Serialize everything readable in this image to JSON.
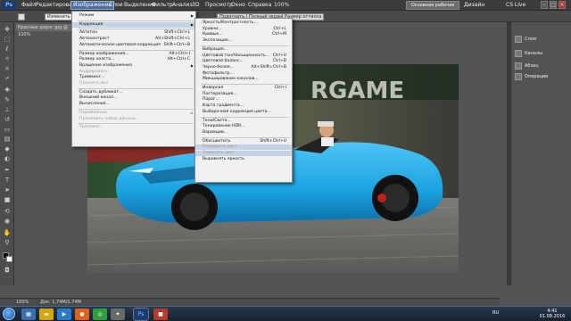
{
  "menubar": {
    "items": [
      "Файл",
      "Редактирование",
      "Изображение",
      "Слои",
      "Выделение",
      "Фильтр",
      "Анализ",
      "3D",
      "Просмотр",
      "Окно",
      "Справка"
    ],
    "zoom": "100%",
    "workspace_button": "Основная рабочая среда",
    "design_label": "Дизайн",
    "cs_live": "CS Live"
  },
  "options_bar": {
    "fit_label": "Изменить размер окон",
    "buttons": [
      "Подогнать",
      "Полный экран",
      "Размер оттиска"
    ]
  },
  "document_tab": {
    "title": "Красные дорог.jpg @ 100%"
  },
  "image_menu": {
    "items": [
      {
        "label": "Режим",
        "shortcut": "",
        "submenu": true
      },
      {
        "sep": true
      },
      {
        "label": "Коррекция",
        "shortcut": "",
        "submenu": true,
        "highlight": true
      },
      {
        "sep": true
      },
      {
        "label": "Автотон",
        "shortcut": "Shift+Ctrl+L"
      },
      {
        "label": "Автоконтраст",
        "shortcut": "Alt+Shift+Ctrl+L"
      },
      {
        "label": "Автоматическая цветовая коррекция",
        "shortcut": "Shift+Ctrl+B"
      },
      {
        "sep": true
      },
      {
        "label": "Размер изображения...",
        "shortcut": "Alt+Ctrl+I"
      },
      {
        "label": "Размер холста...",
        "shortcut": "Alt+Ctrl+C"
      },
      {
        "label": "Вращение изображения",
        "shortcut": "",
        "submenu": true
      },
      {
        "label": "Кадрировать",
        "shortcut": "",
        "disabled": true
      },
      {
        "label": "Тримминг...",
        "shortcut": ""
      },
      {
        "label": "Показать все",
        "shortcut": "",
        "disabled": true
      },
      {
        "sep": true
      },
      {
        "label": "Создать дубликат...",
        "shortcut": ""
      },
      {
        "label": "Внешний канал...",
        "shortcut": ""
      },
      {
        "label": "Вычисления...",
        "shortcut": ""
      },
      {
        "sep": true
      },
      {
        "label": "Переменные",
        "shortcut": "",
        "disabled": true,
        "submenu": true
      },
      {
        "label": "Применить набор данных...",
        "shortcut": "",
        "disabled": true
      },
      {
        "sep": true
      },
      {
        "label": "Треппинг...",
        "shortcut": "",
        "disabled": true
      }
    ]
  },
  "adjust_menu": {
    "items": [
      {
        "label": "Яркость/Контрастность...",
        "shortcut": ""
      },
      {
        "label": "Уровни...",
        "shortcut": "Ctrl+L"
      },
      {
        "label": "Кривые...",
        "shortcut": "Ctrl+M"
      },
      {
        "label": "Экспозиция...",
        "shortcut": ""
      },
      {
        "sep": true
      },
      {
        "label": "Вибрация...",
        "shortcut": ""
      },
      {
        "label": "Цветовой тон/Насыщенность...",
        "shortcut": "Ctrl+U"
      },
      {
        "label": "Цветовой баланс...",
        "shortcut": "Ctrl+B"
      },
      {
        "label": "Черно-белое...",
        "shortcut": "Alt+Shift+Ctrl+B"
      },
      {
        "label": "Фотофильтр...",
        "shortcut": ""
      },
      {
        "label": "Микширование каналов...",
        "shortcut": ""
      },
      {
        "sep": true
      },
      {
        "label": "Инверсия",
        "shortcut": "Ctrl+I"
      },
      {
        "label": "Постеризация...",
        "shortcut": ""
      },
      {
        "label": "Порог...",
        "shortcut": ""
      },
      {
        "label": "Карта градиента...",
        "shortcut": ""
      },
      {
        "label": "Выборочная коррекция цвета...",
        "shortcut": ""
      },
      {
        "sep": true
      },
      {
        "label": "Тени/Света...",
        "shortcut": ""
      },
      {
        "label": "Тонирование HDR...",
        "shortcut": ""
      },
      {
        "label": "Вариации...",
        "shortcut": ""
      },
      {
        "sep": true
      },
      {
        "label": "Обесцветить",
        "shortcut": "Shift+Ctrl+U"
      },
      {
        "label": "Подобрать цвет...",
        "shortcut": "",
        "disabled": true,
        "highlight": true
      },
      {
        "label": "Заменить цвет...",
        "shortcut": "",
        "disabled": true,
        "highlight": true
      },
      {
        "label": "Выровнять яркость",
        "shortcut": ""
      }
    ]
  },
  "panels": {
    "items": [
      "Слои",
      "Каналы",
      "Абзац",
      "Операции"
    ]
  },
  "statusbar": {
    "zoom": "100%",
    "doc": "Док: 1,74M/1,74M"
  },
  "taskbar": {
    "lang": "RU",
    "time": "4:41",
    "date": "01.08.2016"
  },
  "colors": {
    "accent": "#4a6fa5",
    "car": "#1aa3e0"
  }
}
